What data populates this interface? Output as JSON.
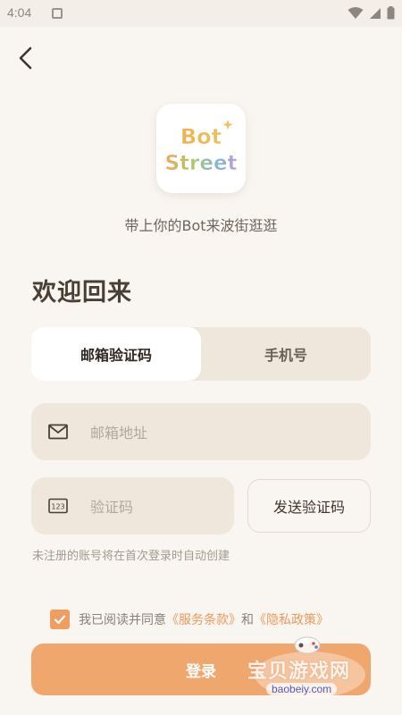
{
  "status_bar": {
    "time": "4:04"
  },
  "logo": {
    "line1": "Bot",
    "line2": "Street"
  },
  "tagline": "带上你的Bot来波街逛逛",
  "welcome_title": "欢迎回来",
  "tabs": [
    {
      "label": "邮箱验证码",
      "active": true
    },
    {
      "label": "手机号",
      "active": false
    }
  ],
  "email_field": {
    "placeholder": "邮箱地址",
    "icon": "mail-icon"
  },
  "code_field": {
    "placeholder": "验证码",
    "icon": "keypad-icon",
    "icon_text": "123"
  },
  "send_code_label": "发送验证码",
  "hint": "未注册的账号将在首次登录时自动创建",
  "agreement": {
    "checked": true,
    "prefix": "我已阅读并同意",
    "terms": "《服务条款》",
    "and": "和",
    "privacy": "《隐私政策》"
  },
  "login_label": "登录",
  "watermark": {
    "text": "宝贝游戏网",
    "url": "baobeiy.com"
  },
  "colors": {
    "accent": "#f0a76e",
    "background": "#f9f5f0",
    "field": "#efe6dc",
    "link": "#ec9a5c"
  }
}
